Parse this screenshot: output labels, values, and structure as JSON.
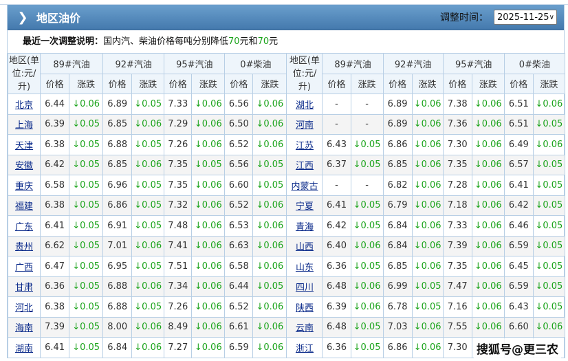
{
  "header": {
    "title": "地区油价",
    "date_label": "调整时间：",
    "date_value": "2025-11-25",
    "chevron_icon": "chevron-right-icon",
    "dropdown_icon": "chevron-down-icon"
  },
  "note": {
    "label": "最近一次调整说明：",
    "text1": "国内汽、柴油价格每吨分别降低",
    "v1": "70",
    "text2": "元和",
    "v2": "70",
    "text3": "元"
  },
  "table": {
    "region_header": "地区(单位:元/升)",
    "fuel_headers": [
      "89#汽油",
      "92#汽油",
      "95#汽油",
      "0#柴油"
    ],
    "sub_headers": [
      "价格",
      "涨跌"
    ],
    "left": [
      [
        "北京",
        "6.44",
        "↓0.06",
        "6.89",
        "↓0.05",
        "7.33",
        "↓0.06",
        "6.56",
        "↓0.06"
      ],
      [
        "上海",
        "6.39",
        "↓0.05",
        "6.85",
        "↓0.06",
        "7.29",
        "↓0.06",
        "6.50",
        "↓0.06"
      ],
      [
        "天津",
        "6.38",
        "↓0.05",
        "6.88",
        "↓0.05",
        "7.26",
        "↓0.06",
        "6.52",
        "↓0.06"
      ],
      [
        "安徽",
        "6.42",
        "↓0.05",
        "6.85",
        "↓0.06",
        "7.35",
        "↓0.05",
        "6.56",
        "↓0.05"
      ],
      [
        "重庆",
        "6.58",
        "↓0.05",
        "6.96",
        "↓0.05",
        "7.35",
        "↓0.06",
        "6.60",
        "↓0.05"
      ],
      [
        "福建",
        "6.38",
        "↓0.05",
        "6.86",
        "↓0.05",
        "7.32",
        "↓0.06",
        "6.52",
        "↓0.06"
      ],
      [
        "广东",
        "6.41",
        "↓0.05",
        "6.91",
        "↓0.05",
        "7.48",
        "↓0.06",
        "6.53",
        "↓0.06"
      ],
      [
        "贵州",
        "6.62",
        "↓0.05",
        "7.01",
        "↓0.06",
        "7.41",
        "↓0.06",
        "6.63",
        "↓0.06"
      ],
      [
        "广西",
        "6.47",
        "↓0.05",
        "6.95",
        "↓0.05",
        "7.51",
        "↓0.06",
        "6.58",
        "↓0.06"
      ],
      [
        "甘肃",
        "6.36",
        "↓0.05",
        "6.88",
        "↓0.06",
        "7.34",
        "↓0.06",
        "6.44",
        "↓0.05"
      ],
      [
        "河北",
        "6.38",
        "↓0.05",
        "6.88",
        "↓0.05",
        "7.26",
        "↓0.06",
        "6.52",
        "↓0.06"
      ],
      [
        "海南",
        "7.39",
        "↓0.05",
        "8.00",
        "↓0.06",
        "8.49",
        "↓0.06",
        "6.61",
        "↓0.06"
      ],
      [
        "湖南",
        "6.41",
        "↓0.05",
        "6.84",
        "↓0.06",
        "7.27",
        "↓0.06",
        "6.59",
        "↓0.06"
      ]
    ],
    "right": [
      [
        "湖北",
        "-",
        "-",
        "6.89",
        "↓0.06",
        "7.38",
        "↓0.06",
        "6.51",
        "↓0.06"
      ],
      [
        "河南",
        "-",
        "-",
        "6.89",
        "↓0.06",
        "7.36",
        "↓0.06",
        "6.51",
        "↓0.05"
      ],
      [
        "江苏",
        "6.43",
        "↓0.05",
        "6.86",
        "↓0.06",
        "7.30",
        "↓0.06",
        "6.49",
        "↓0.06"
      ],
      [
        "江西",
        "6.37",
        "↓0.05",
        "6.85",
        "↓0.06",
        "7.35",
        "↓0.06",
        "6.57",
        "↓0.05"
      ],
      [
        "内蒙古",
        "-",
        "-",
        "6.82",
        "↓0.06",
        "7.28",
        "↓0.06",
        "6.41",
        "↓0.05"
      ],
      [
        "宁夏",
        "6.41",
        "↓0.05",
        "6.79",
        "↓0.06",
        "7.18",
        "↓0.06",
        "6.42",
        "↓0.05"
      ],
      [
        "青海",
        "6.42",
        "↓0.05",
        "6.84",
        "↓0.06",
        "7.33",
        "↓0.06",
        "6.46",
        "↓0.05"
      ],
      [
        "山西",
        "6.40",
        "↓0.06",
        "6.84",
        "↓0.06",
        "7.39",
        "↓0.06",
        "6.59",
        "↓0.05"
      ],
      [
        "山东",
        "6.36",
        "↓0.05",
        "6.85",
        "↓0.06",
        "7.35",
        "↓0.06",
        "6.45",
        "↓0.05"
      ],
      [
        "四川",
        "6.48",
        "↓0.06",
        "6.99",
        "↓0.05",
        "7.47",
        "↓0.06",
        "6.59",
        "↓0.05"
      ],
      [
        "陕西",
        "6.39",
        "↓0.06",
        "6.78",
        "↓0.05",
        "7.16",
        "↓0.06",
        "6.43",
        "↓0.05"
      ],
      [
        "云南",
        "6.48",
        "↓0.05",
        "7.03",
        "↓0.06",
        "7.55",
        "↓0.06",
        "6.60",
        "↓0.06"
      ],
      [
        "浙江",
        "6.36",
        "↓0.05",
        "6.86",
        "↓0.06",
        "7.30",
        "",
        "",
        "",
        ""
      ]
    ]
  },
  "watermark": "搜狐号@更三农"
}
